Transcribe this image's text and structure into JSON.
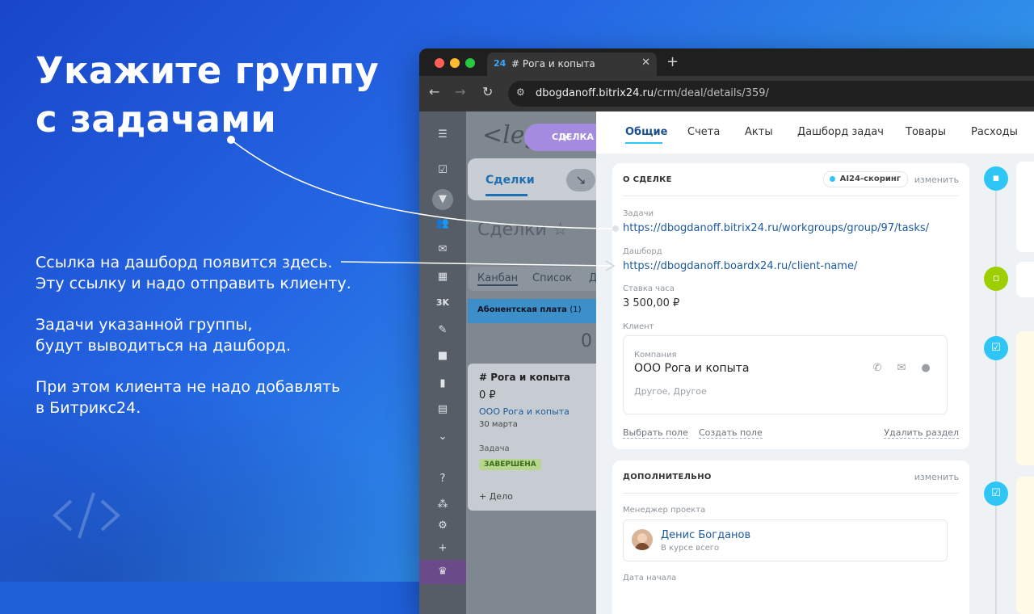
{
  "slide": {
    "headline": [
      "Укажите группу",
      "с задачами"
    ],
    "annotation_1": [
      "Ссылка на дашборд появится здесь.",
      "Эту ссылку и надо отправить клиенту."
    ],
    "annotation_2": [
      "Задачи указанной группы,",
      "будут выводиться на дашборд."
    ],
    "annotation_3": [
      "При этом клиента не надо добавлять",
      "в Битрикс24."
    ]
  },
  "browser": {
    "tab_favicon": "24",
    "tab_title": "# Рога и копыта",
    "url_host": "dbogdanoff.bitrix24.ru",
    "url_path": "/crm/deal/details/359/"
  },
  "crm": {
    "deal_chip": "СДЕЛКА",
    "tab_label": "Сделки",
    "title": "Сделки ☆",
    "views": [
      "Канбан",
      "Список",
      "Д"
    ],
    "column_title": "Абонентская плата",
    "column_count": "(1)",
    "column_sum": "0",
    "card": {
      "title": "# Рога и копыта",
      "sum": "0 ₽",
      "company": "ООО Рога и копыта",
      "date": "30 марта",
      "task_label": "Задача",
      "task_status": "ЗАВЕРШЕНА",
      "add": "+ Дело"
    }
  },
  "deal": {
    "tabs": [
      "Общие",
      "Счета",
      "Акты",
      "Дашборд задач",
      "Товары",
      "Расходы"
    ],
    "about": {
      "heading": "О СДЕЛКЕ",
      "ai_chip": "AI24-скоринг",
      "edit": "изменить",
      "tasks_label": "Задачи",
      "tasks_value": "https://dbogdanoff.bitrix24.ru/workgroups/group/97/tasks/",
      "dashboard_label": "Дашборд",
      "dashboard_value": "https://dbogdanoff.boardx24.ru/client-name/",
      "rate_label": "Ставка часа",
      "rate_value": "3 500,00 ₽",
      "client_label": "Клиент",
      "company_label": "Компания",
      "company_name": "ООО Рога и копыта",
      "company_sub": "Другое, Другое",
      "select_field": "Выбрать поле",
      "create_field": "Создать поле",
      "delete_section": "Удалить раздел"
    },
    "extra": {
      "heading": "ДОПОЛНИТЕЛЬНО",
      "edit": "изменить",
      "manager_label": "Менеджер проекта",
      "manager_name": "Денис Богданов",
      "manager_sub": "В курсе всего",
      "start_label": "Дата начала"
    }
  },
  "colors": {
    "accent_cyan": "#2fc6f6",
    "link_blue": "#1d5a9c",
    "green": "#9dcf00"
  }
}
